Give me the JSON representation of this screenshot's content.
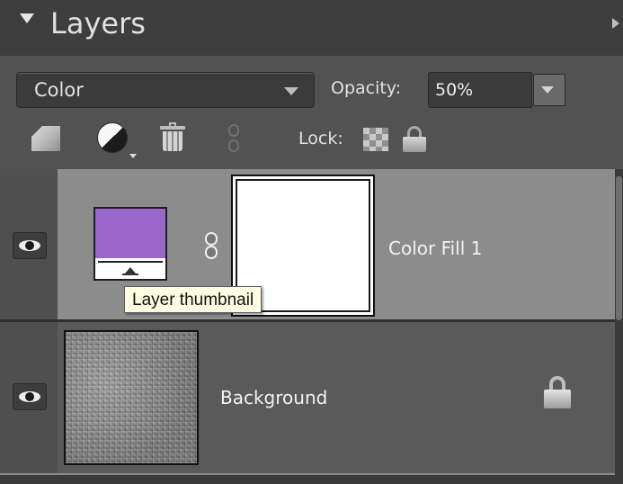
{
  "panel": {
    "title": "Layers"
  },
  "blend_mode": {
    "value": "Color"
  },
  "opacity": {
    "label": "Opacity:",
    "value": "50%"
  },
  "toolbar": {
    "lock_label": "Lock:",
    "icons": [
      "new-layer-icon",
      "adjustment-layer-icon",
      "trash-icon",
      "link-icon",
      "lock-transparency-icon",
      "lock-all-icon"
    ]
  },
  "layers": [
    {
      "name": "Color Fill 1",
      "visible": true,
      "selected": true,
      "fill_color": "#9a66cc",
      "has_mask": true
    },
    {
      "name": "Background",
      "visible": true,
      "selected": false,
      "locked": true
    }
  ],
  "tooltip": {
    "text": "Layer thumbnail"
  }
}
